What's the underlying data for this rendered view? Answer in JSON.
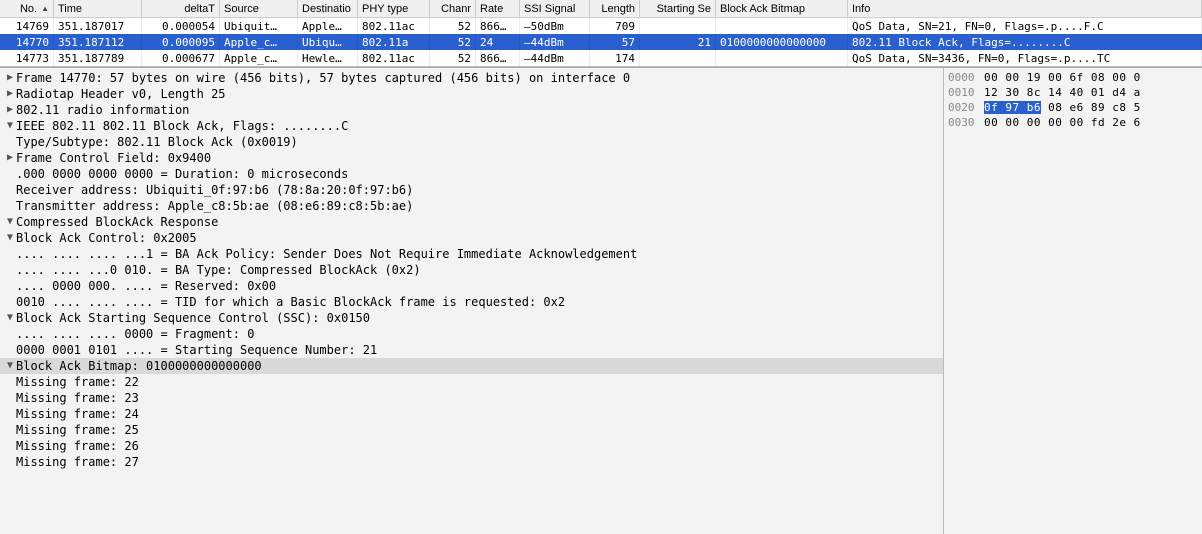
{
  "columns": {
    "no": "No.",
    "time": "Time",
    "deltat": "deltaT",
    "src": "Source",
    "dst": "Destinatio",
    "phy": "PHY type",
    "chan": "Chanr",
    "rate": "Rate",
    "ssi": "SSI Signal",
    "len": "Length",
    "sseq": "Starting Se",
    "bab": "Block Ack Bitmap",
    "info": "Info"
  },
  "rows": [
    {
      "no": "14769",
      "time": "351.187017",
      "deltat": "0.000054",
      "src": "Ubiquit…",
      "dst": "Apple…",
      "phy": "802.11ac",
      "chan": "52",
      "rate": "866…",
      "ssi": "–50dBm",
      "len": "709",
      "sseq": "",
      "bab": "",
      "info": "QoS Data, SN=21, FN=0, Flags=.p....F.C"
    },
    {
      "no": "14770",
      "time": "351.187112",
      "deltat": "0.000095",
      "src": "Apple_c…",
      "dst": "Ubiqu…",
      "phy": "802.11a",
      "chan": "52",
      "rate": "24",
      "ssi": "–44dBm",
      "len": "57",
      "sseq": "21",
      "bab": "0100000000000000",
      "info": "802.11 Block Ack, Flags=........C",
      "selected": true
    },
    {
      "no": "14773",
      "time": "351.187789",
      "deltat": "0.000677",
      "src": "Apple_c…",
      "dst": "Hewle…",
      "phy": "802.11ac",
      "chan": "52",
      "rate": "866…",
      "ssi": "–44dBm",
      "len": "174",
      "sseq": "",
      "bab": "",
      "info": "QoS Data, SN=3436, FN=0, Flags=.p....TC"
    }
  ],
  "tree": [
    {
      "ind": 0,
      "tog": "▶",
      "txt": "Frame 14770: 57 bytes on wire (456 bits), 57 bytes captured (456 bits) on interface 0"
    },
    {
      "ind": 0,
      "tog": "▶",
      "txt": "Radiotap Header v0, Length 25"
    },
    {
      "ind": 0,
      "tog": "▶",
      "txt": "802.11 radio information"
    },
    {
      "ind": 0,
      "tog": "▼",
      "txt": "IEEE 802.11 802.11 Block Ack, Flags: ........C"
    },
    {
      "ind": 1,
      "tog": "",
      "txt": "Type/Subtype: 802.11 Block Ack (0x0019)"
    },
    {
      "ind": 1,
      "tog": "▶",
      "txt": "Frame Control Field: 0x9400"
    },
    {
      "ind": 1,
      "tog": "",
      "txt": ".000 0000 0000 0000 = Duration: 0 microseconds"
    },
    {
      "ind": 1,
      "tog": "",
      "txt": "Receiver address: Ubiquiti_0f:97:b6 (78:8a:20:0f:97:b6)"
    },
    {
      "ind": 1,
      "tog": "",
      "txt": "Transmitter address: Apple_c8:5b:ae (08:e6:89:c8:5b:ae)"
    },
    {
      "ind": 1,
      "tog": "▼",
      "txt": "Compressed BlockAck Response"
    },
    {
      "ind": 2,
      "tog": "▼",
      "txt": "Block Ack Control: 0x2005"
    },
    {
      "ind": 3,
      "tog": "",
      "txt": ".... .... .... ...1 = BA Ack Policy: Sender Does Not Require Immediate Acknowledgement"
    },
    {
      "ind": 3,
      "tog": "",
      "txt": ".... .... ...0 010. = BA Type: Compressed BlockAck (0x2)"
    },
    {
      "ind": 3,
      "tog": "",
      "txt": ".... 0000 000. .... = Reserved: 0x00"
    },
    {
      "ind": 3,
      "tog": "",
      "txt": "0010 .... .... .... = TID for which a Basic BlockAck frame is requested: 0x2"
    },
    {
      "ind": 2,
      "tog": "▼",
      "txt": "Block Ack Starting Sequence Control (SSC): 0x0150"
    },
    {
      "ind": 3,
      "tog": "",
      "txt": ".... .... .... 0000 = Fragment: 0"
    },
    {
      "ind": 3,
      "tog": "",
      "txt": "0000 0001 0101 .... = Starting Sequence Number: 21"
    },
    {
      "ind": 2,
      "tog": "▼",
      "txt": "Block Ack Bitmap: 0100000000000000",
      "hl": true
    },
    {
      "ind": 3,
      "tog": "",
      "txt": "Missing frame: 22"
    },
    {
      "ind": 3,
      "tog": "",
      "txt": "Missing frame: 23"
    },
    {
      "ind": 3,
      "tog": "",
      "txt": "Missing frame: 24"
    },
    {
      "ind": 3,
      "tog": "",
      "txt": "Missing frame: 25"
    },
    {
      "ind": 3,
      "tog": "",
      "txt": "Missing frame: 26"
    },
    {
      "ind": 3,
      "tog": "",
      "txt": "Missing frame: 27"
    }
  ],
  "hex": [
    {
      "off": "0000",
      "pre": "00 00 19 00 6f 08 00 0",
      "sel": "",
      "post": ""
    },
    {
      "off": "0010",
      "pre": "12 30 8c 14 40 01 d4 a",
      "sel": "",
      "post": ""
    },
    {
      "off": "0020",
      "pre": "",
      "sel": "0f 97 b6",
      "post": " 08 e6 89 c8 5"
    },
    {
      "off": "0030",
      "pre": "00 00 00 00 00 fd 2e 6",
      "sel": "",
      "post": ""
    }
  ]
}
